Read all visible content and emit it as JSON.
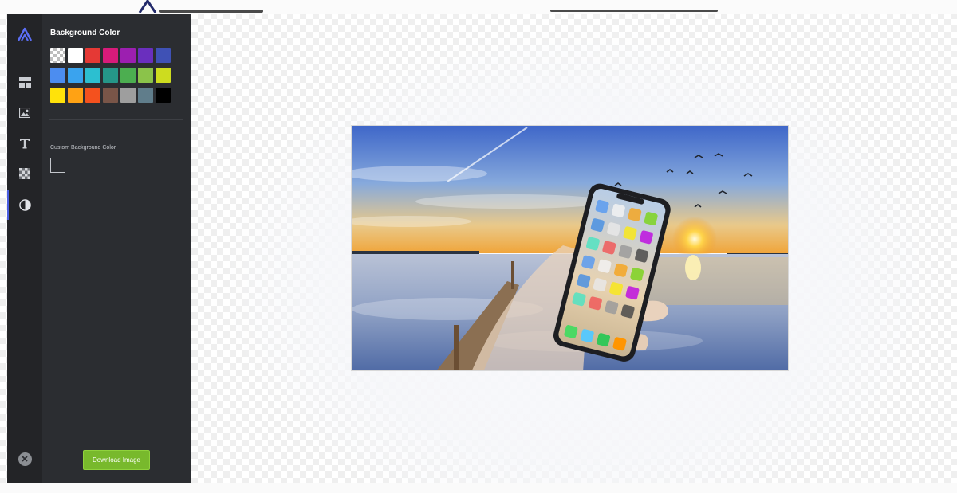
{
  "sidebar": {
    "icons": [
      {
        "name": "app-logo-icon"
      },
      {
        "name": "layout-icon"
      },
      {
        "name": "image-icon"
      },
      {
        "name": "text-icon"
      },
      {
        "name": "background-pattern-icon"
      },
      {
        "name": "contrast-icon",
        "active": true
      },
      {
        "name": "close-icon"
      }
    ]
  },
  "panel": {
    "title": "Background Color",
    "swatches": [
      "transparent",
      "#ffffff",
      "#e53935",
      "#d81b7a",
      "#9c1fb0",
      "#6a2fbe",
      "#3f51b5",
      "#4c8df0",
      "#3aa3ee",
      "#2cbfd0",
      "#259688",
      "#4cae50",
      "#8bc34a",
      "#cddc1f",
      "#ffe20a",
      "#ffa214",
      "#f4511e",
      "#795548",
      "#9e9e9e",
      "#607d8b",
      "#000000"
    ],
    "custom_label": "Custom Background Color",
    "download_label": "Download Image"
  },
  "colors": {
    "rail_bg": "#232427",
    "panel_bg": "#2b2d31",
    "accent": "#4a5de0",
    "download_button": "#78b92c"
  }
}
